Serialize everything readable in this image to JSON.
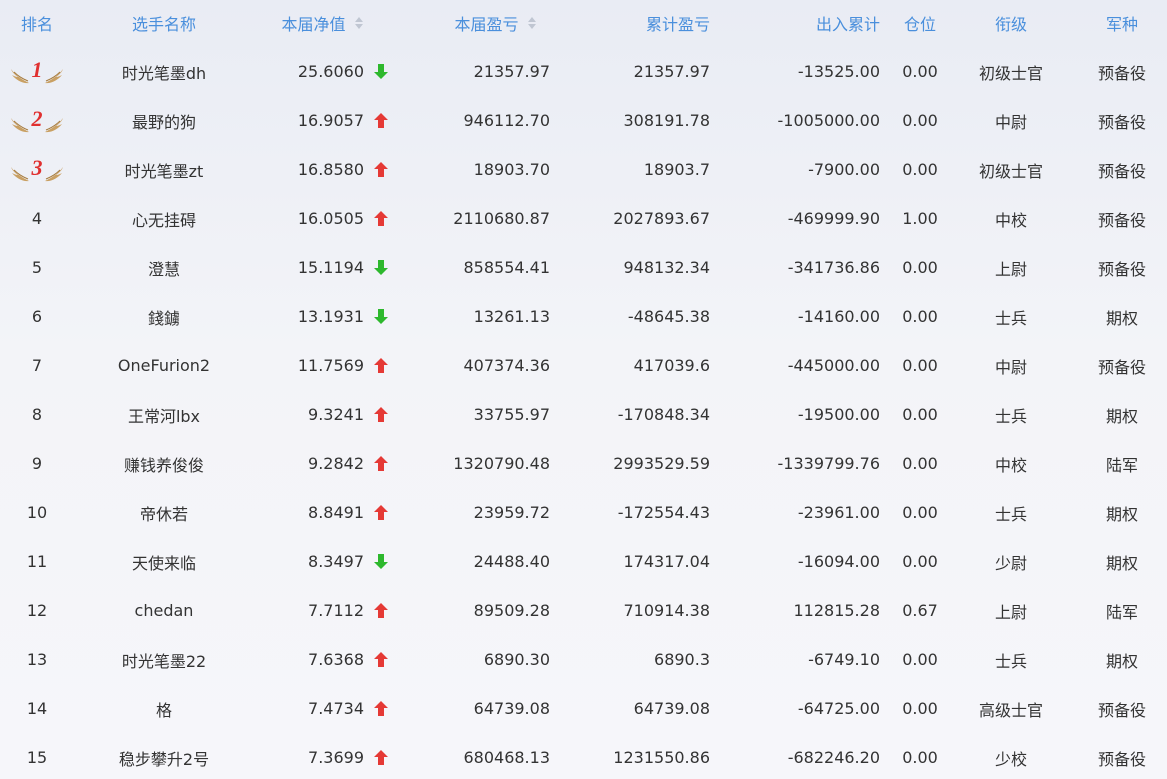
{
  "colors": {
    "header_text": "#4a8fdc",
    "up_arrow": "#e53935",
    "down_arrow": "#2db82d",
    "medal_number": "#e03030",
    "medal_wing": "#c9a063"
  },
  "header": {
    "rank": "排名",
    "name": "选手名称",
    "net_value": "本届净值",
    "profit": "本届盈亏",
    "cumulative": "累计盈亏",
    "flow": "出入累计",
    "position": "仓位",
    "title": "衔级",
    "army": "军种"
  },
  "rows": [
    {
      "rank": "1",
      "medal": "medal-wings-icon",
      "name": "时光笔墨dh",
      "net": "25.6060",
      "trend": "down",
      "profit": "21357.97",
      "cumulative": "21357.97",
      "flow": "-13525.00",
      "position": "0.00",
      "title": "初级士官",
      "army": "预备役"
    },
    {
      "rank": "2",
      "medal": "medal-wings-icon",
      "name": "最野的狗",
      "net": "16.9057",
      "trend": "up",
      "profit": "946112.70",
      "cumulative": "308191.78",
      "flow": "-1005000.00",
      "position": "0.00",
      "title": "中尉",
      "army": "预备役"
    },
    {
      "rank": "3",
      "medal": "medal-wings-icon",
      "name": "时光笔墨zt",
      "net": "16.8580",
      "trend": "up",
      "profit": "18903.70",
      "cumulative": "18903.7",
      "flow": "-7900.00",
      "position": "0.00",
      "title": "初级士官",
      "army": "预备役"
    },
    {
      "rank": "4",
      "name": "心无挂碍",
      "net": "16.0505",
      "trend": "up",
      "profit": "2110680.87",
      "cumulative": "2027893.67",
      "flow": "-469999.90",
      "position": "1.00",
      "title": "中校",
      "army": "预备役"
    },
    {
      "rank": "5",
      "name": "澄慧",
      "net": "15.1194",
      "trend": "down",
      "profit": "858554.41",
      "cumulative": "948132.34",
      "flow": "-341736.86",
      "position": "0.00",
      "title": "上尉",
      "army": "预备役"
    },
    {
      "rank": "6",
      "name": "錢鐪",
      "net": "13.1931",
      "trend": "down",
      "profit": "13261.13",
      "cumulative": "-48645.38",
      "flow": "-14160.00",
      "position": "0.00",
      "title": "士兵",
      "army": "期权"
    },
    {
      "rank": "7",
      "name": "OneFurion2",
      "net": "11.7569",
      "trend": "up",
      "profit": "407374.36",
      "cumulative": "417039.6",
      "flow": "-445000.00",
      "position": "0.00",
      "title": "中尉",
      "army": "预备役"
    },
    {
      "rank": "8",
      "name": "王常河lbx",
      "net": "9.3241",
      "trend": "up",
      "profit": "33755.97",
      "cumulative": "-170848.34",
      "flow": "-19500.00",
      "position": "0.00",
      "title": "士兵",
      "army": "期权"
    },
    {
      "rank": "9",
      "name": "赚钱养俊俊",
      "net": "9.2842",
      "trend": "up",
      "profit": "1320790.48",
      "cumulative": "2993529.59",
      "flow": "-1339799.76",
      "position": "0.00",
      "title": "中校",
      "army": "陆军"
    },
    {
      "rank": "10",
      "name": "帝休若",
      "net": "8.8491",
      "trend": "up",
      "profit": "23959.72",
      "cumulative": "-172554.43",
      "flow": "-23961.00",
      "position": "0.00",
      "title": "士兵",
      "army": "期权"
    },
    {
      "rank": "11",
      "name": "天使来临",
      "net": "8.3497",
      "trend": "down",
      "profit": "24488.40",
      "cumulative": "174317.04",
      "flow": "-16094.00",
      "position": "0.00",
      "title": "少尉",
      "army": "期权"
    },
    {
      "rank": "12",
      "name": "chedan",
      "net": "7.7112",
      "trend": "up",
      "profit": "89509.28",
      "cumulative": "710914.38",
      "flow": "112815.28",
      "position": "0.67",
      "title": "上尉",
      "army": "陆军"
    },
    {
      "rank": "13",
      "name": "时光笔墨22",
      "net": "7.6368",
      "trend": "up",
      "profit": "6890.30",
      "cumulative": "6890.3",
      "flow": "-6749.10",
      "position": "0.00",
      "title": "士兵",
      "army": "期权"
    },
    {
      "rank": "14",
      "name": "格",
      "net": "7.4734",
      "trend": "up",
      "profit": "64739.08",
      "cumulative": "64739.08",
      "flow": "-64725.00",
      "position": "0.00",
      "title": "高级士官",
      "army": "预备役"
    },
    {
      "rank": "15",
      "name": "稳步攀升2号",
      "net": "7.3699",
      "trend": "up",
      "profit": "680468.13",
      "cumulative": "1231550.86",
      "flow": "-682246.20",
      "position": "0.00",
      "title": "少校",
      "army": "预备役"
    }
  ]
}
